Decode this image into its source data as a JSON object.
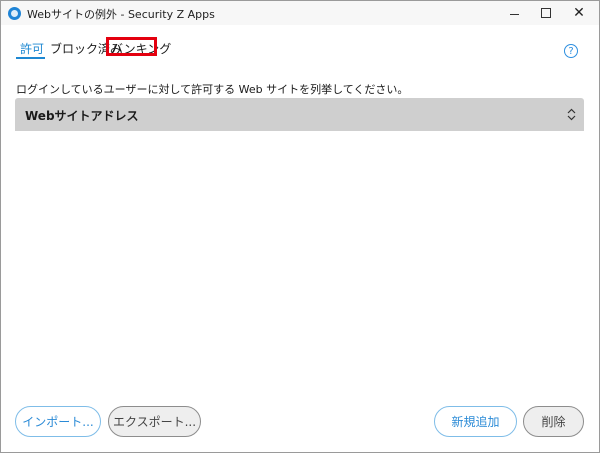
{
  "window": {
    "title": "Webサイトの例外 - Security Z Apps",
    "controls": {
      "minimize": "minimize",
      "maximize": "maximize",
      "close": "✕"
    }
  },
  "tabs": [
    {
      "label": "許可",
      "selected": true
    },
    {
      "label": "ブロック済み",
      "selected": false
    },
    {
      "label": "バンキング",
      "selected": false,
      "highlighted": true
    }
  ],
  "help": {
    "label": "?"
  },
  "description": "ログインしているユーザーに対して許可する Web サイトを列挙してください。",
  "table": {
    "columns": [
      {
        "label": "Webサイトアドレス"
      }
    ],
    "rows": []
  },
  "buttons": {
    "import": "インポート...",
    "export": "エクスポート...",
    "add": "新規追加",
    "delete": "削除"
  },
  "colors": {
    "accent": "#1e88d2",
    "highlight_box": "#e4000f",
    "header_bg": "#cfcfcf"
  }
}
